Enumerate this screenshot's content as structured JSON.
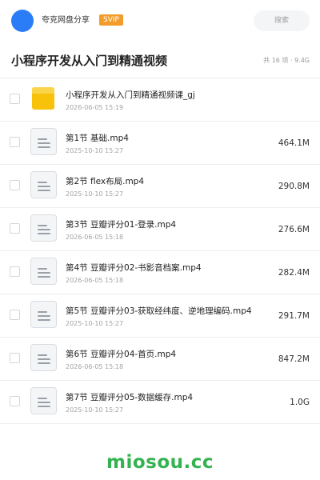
{
  "header": {
    "user_name": "夸克网盘分享",
    "badge": "SVIP",
    "search_placeholder": "搜索"
  },
  "folder": {
    "title": "小程序开发从入门到精通视频",
    "stats": "共 16 项 · 9.4G"
  },
  "files": [
    {
      "name": "小程序开发从入门到精通视频课_gj",
      "date": "2026-06-05 15:19",
      "size": "",
      "type": "folder"
    },
    {
      "name": "第1节 基础.mp4",
      "date": "2025-10-10 15:27",
      "size": "464.1M",
      "type": "video"
    },
    {
      "name": "第2节 flex布局.mp4",
      "date": "2025-10-10 15:27",
      "size": "290.8M",
      "type": "video"
    },
    {
      "name": "第3节 豆瓣评分01-登录.mp4",
      "date": "2026-06-05 15:18",
      "size": "276.6M",
      "type": "video"
    },
    {
      "name": "第4节 豆瓣评分02-书影音档案.mp4",
      "date": "2026-06-05 15:18",
      "size": "282.4M",
      "type": "video"
    },
    {
      "name": "第5节 豆瓣评分03-获取经纬度、逆地理编码.mp4",
      "date": "2025-10-10 15:27",
      "size": "291.7M",
      "type": "video"
    },
    {
      "name": "第6节 豆瓣评分04-首页.mp4",
      "date": "2026-06-05 15:18",
      "size": "847.2M",
      "type": "video"
    },
    {
      "name": "第7节 豆瓣评分05-数据缓存.mp4",
      "date": "2025-10-10 15:27",
      "size": "1.0G",
      "type": "video"
    }
  ],
  "watermark": "miosou.cc",
  "colors": {
    "accent": "#2b7df7",
    "badge": "#f39c2a",
    "folder": "#f9c20a",
    "watermark": "#33b24f"
  }
}
